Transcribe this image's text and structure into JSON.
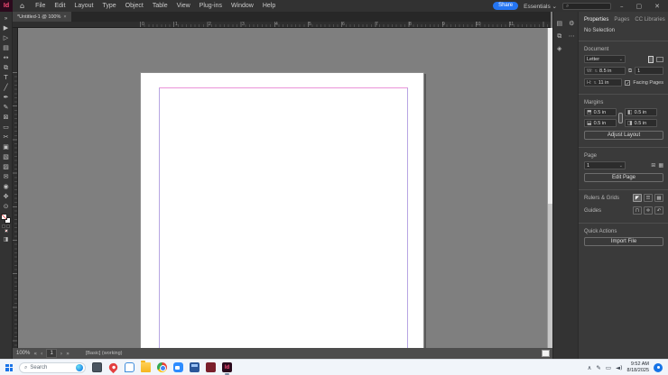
{
  "titlebar": {
    "app_badge": "Id",
    "home_icon": "⌂",
    "menus": [
      "File",
      "Edit",
      "Layout",
      "Type",
      "Object",
      "Table",
      "View",
      "Plug-ins",
      "Window",
      "Help"
    ],
    "share_label": "Share",
    "workspace_label": "Essentials ⌄",
    "search_icon": "⌕",
    "window_controls": {
      "minimize": "–",
      "maximize": "▢",
      "close": "✕"
    }
  },
  "document_tab": {
    "title": "*Untitled-1 @ 100%",
    "close_glyph": "×"
  },
  "toolbar": {
    "collapse_glyph": "»",
    "tools": [
      {
        "name": "selection-tool",
        "glyph": "▶"
      },
      {
        "name": "direct-selection-tool",
        "glyph": "▷"
      },
      {
        "name": "page-tool",
        "glyph": "▤"
      },
      {
        "name": "gap-tool",
        "glyph": "↔"
      },
      {
        "name": "content-collector-tool",
        "glyph": "⧉"
      },
      {
        "name": "type-tool",
        "glyph": "T"
      },
      {
        "name": "line-tool",
        "glyph": "╱"
      },
      {
        "name": "pen-tool",
        "glyph": "✒"
      },
      {
        "name": "pencil-tool",
        "glyph": "✎"
      },
      {
        "name": "rectangle-frame-tool",
        "glyph": "⊠"
      },
      {
        "name": "rectangle-tool",
        "glyph": "▭"
      },
      {
        "name": "scissors-tool",
        "glyph": "✂"
      },
      {
        "name": "free-transform-tool",
        "glyph": "▣"
      },
      {
        "name": "gradient-swatch-tool",
        "glyph": "▧"
      },
      {
        "name": "gradient-feather-tool",
        "glyph": "▨"
      },
      {
        "name": "note-tool",
        "glyph": "✉"
      },
      {
        "name": "eyedropper-tool",
        "glyph": "◉"
      },
      {
        "name": "hand-tool",
        "glyph": "✥"
      },
      {
        "name": "zoom-tool",
        "glyph": "⊙"
      }
    ],
    "screen_mode_glyph": "◨"
  },
  "ruler": {
    "h_numbers": [
      "0",
      "1",
      "2",
      "3",
      "4",
      "5",
      "6",
      "7",
      "8",
      "9",
      "10",
      "11"
    ]
  },
  "dock": {
    "panel_icons": [
      {
        "name": "pages-panel-icon",
        "glyph": "▤"
      },
      {
        "name": "links-panel-icon",
        "glyph": "⧉"
      },
      {
        "name": "layers-panel-icon",
        "glyph": "◈"
      },
      {
        "name": "gear-icon",
        "glyph": "⚙"
      },
      {
        "name": "overflow-icon",
        "glyph": "⋯"
      }
    ]
  },
  "properties_panel": {
    "tabs": [
      "Properties",
      "Pages",
      "CC Libraries"
    ],
    "selection_status": "No Selection",
    "document_section": {
      "label": "Document",
      "page_size_value": "Letter",
      "width_label": "W:",
      "width_value": "8.5 in",
      "height_label": "H:",
      "height_value": "11 in",
      "pages_count": "1",
      "facing_pages_label": "Facing Pages",
      "facing_pages_check": "✓"
    },
    "margins_section": {
      "label": "Margins",
      "top": "0.5 in",
      "bottom": "0.5 in",
      "inside": "0.5 in",
      "outside": "0.5 in",
      "adjust_layout_label": "Adjust Layout"
    },
    "page_section": {
      "label": "Page",
      "current_page": "1",
      "edit_page_label": "Edit Page"
    },
    "rulers_grids_label": "Rulers & Grids",
    "guides_label": "Guides",
    "quick_actions_label": "Quick Actions",
    "import_file_label": "Import File"
  },
  "status_bar": {
    "zoom_level": "100%",
    "page_number": "1",
    "preflight_text": "[Basic] (working)"
  },
  "taskbar": {
    "search_label": "Search",
    "clock": {
      "time": "9:52 AM",
      "date": "8/18/2025"
    }
  }
}
